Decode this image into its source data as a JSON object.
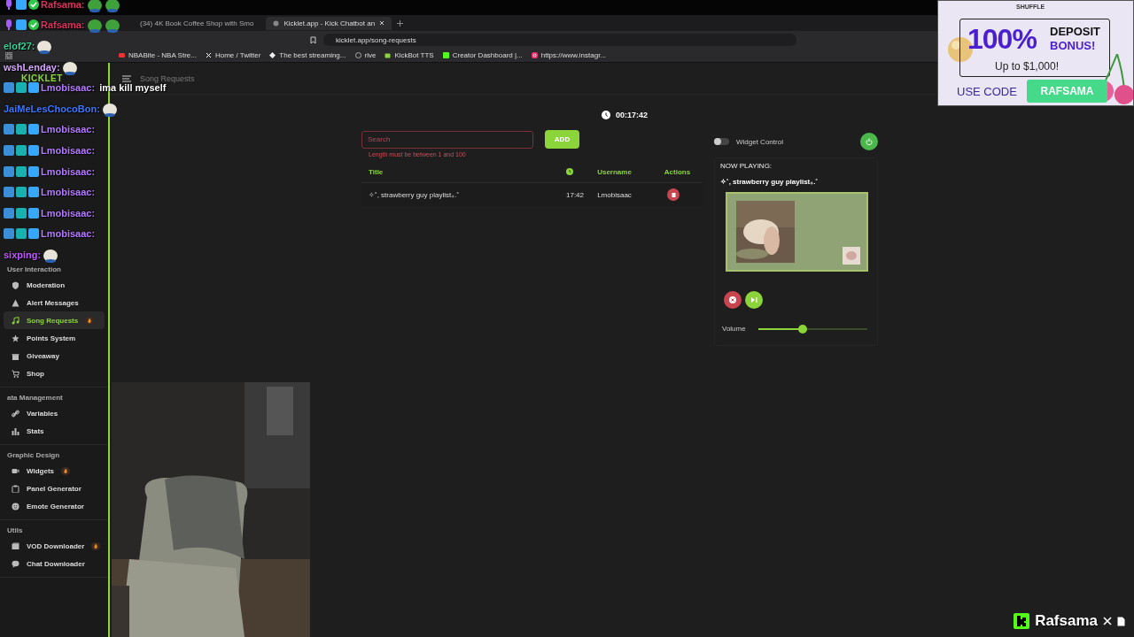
{
  "browser": {
    "tabs": [
      {
        "title": "(34) 4K Book Coffee Shop with Smo",
        "selected": false
      },
      {
        "title": "Kicklet.app - Kick Chatbot an",
        "selected": true
      }
    ],
    "url": "kicklet.app/song-requests",
    "bookmarks": [
      {
        "label": "NBABite - NBA Stre...",
        "kind": "video"
      },
      {
        "label": "Home / Twitter",
        "kind": "x"
      },
      {
        "label": "The best streaming...",
        "kind": "diamond"
      },
      {
        "label": "rive",
        "kind": "globe"
      },
      {
        "label": "KickBot TTS",
        "kind": "bot"
      },
      {
        "label": "Creator Dashboard |...",
        "kind": "kick"
      },
      {
        "label": "https://www.instagr...",
        "kind": "insta"
      }
    ]
  },
  "app": {
    "logo": "KICKLET",
    "page_title": "Song Requests",
    "sidebar": [
      {
        "title": "User Interaction",
        "items": [
          {
            "label": "Moderation",
            "kind": "shield",
            "selected": false,
            "hot": false
          },
          {
            "label": "Alert Messages",
            "kind": "alert",
            "selected": false,
            "hot": false
          },
          {
            "label": "Song Requests",
            "kind": "music",
            "selected": true,
            "hot": true
          },
          {
            "label": "Points System",
            "kind": "star",
            "selected": false,
            "hot": false
          },
          {
            "label": "Giveaway",
            "kind": "gift",
            "selected": false,
            "hot": false
          },
          {
            "label": "Shop",
            "kind": "cart",
            "selected": false,
            "hot": false
          }
        ]
      },
      {
        "title": "ata Management",
        "items": [
          {
            "label": "Variables",
            "kind": "link",
            "selected": false,
            "hot": false
          },
          {
            "label": "Stats",
            "kind": "chart",
            "selected": false,
            "hot": false
          }
        ]
      },
      {
        "title": "Graphic Design",
        "items": [
          {
            "label": "Widgets",
            "kind": "video",
            "selected": false,
            "hot": true
          },
          {
            "label": "Panel Generator",
            "kind": "panel",
            "selected": false,
            "hot": false
          },
          {
            "label": "Emote Generator",
            "kind": "smile",
            "selected": false,
            "hot": false
          }
        ]
      },
      {
        "title": "Utils",
        "items": [
          {
            "label": "VOD Downloader",
            "kind": "film",
            "selected": false,
            "hot": true
          },
          {
            "label": "Chat Downloader",
            "kind": "chat",
            "selected": false,
            "hot": false
          }
        ]
      }
    ],
    "timer": "00:17:42",
    "search": {
      "placeholder": "Search",
      "error": "Length must be between 1 and 100"
    },
    "add_button": "ADD",
    "table": {
      "columns": [
        "Title",
        "Username",
        "Actions"
      ],
      "rows": [
        {
          "title": "✧˚, strawberry guy playlist₊.˚",
          "duration": "17:42",
          "username": "Lmobisaac"
        }
      ]
    },
    "widget_control": {
      "label": "Widget Control",
      "on": false
    },
    "now_playing": {
      "heading": "NOW PLAYING:",
      "title": "✧˚, strawberry guy playlist₊.˚",
      "volume_label": "Volume",
      "level": 0.41
    }
  },
  "stream_overlay": {
    "chat": [
      {
        "user": "Rafsama:",
        "color": "#e0305f",
        "kind": "broadcaster",
        "emote": true
      },
      {
        "user": "Rafsama:",
        "color": "#e0305f",
        "kind": "broadcaster",
        "emote": true
      },
      {
        "user": "elof27:",
        "color": "#36d39a",
        "kind": "viewer",
        "emote": true
      },
      {
        "user": "wshLenday:",
        "color": "#d7a6ff",
        "kind": "viewer",
        "emote": true
      },
      {
        "user": "Lmobisaac:",
        "color": "#b57cff",
        "kind": "subscriber",
        "message": "ima kill myself",
        "emote": false
      },
      {
        "user": "JaiMeLesChocoBon:",
        "color": "#3b78ff",
        "kind": "viewer",
        "emote": true
      },
      {
        "user": "Lmobisaac:",
        "color": "#b57cff",
        "kind": "subscriber",
        "emote": false
      },
      {
        "user": "Lmobisaac:",
        "color": "#b57cff",
        "kind": "subscriber",
        "emote": false
      },
      {
        "user": "Lmobisaac:",
        "color": "#b57cff",
        "kind": "subscriber",
        "emote": false
      },
      {
        "user": "Lmobisaac:",
        "color": "#b57cff",
        "kind": "subscriber",
        "emote": false
      },
      {
        "user": "Lmobisaac:",
        "color": "#b57cff",
        "kind": "subscriber",
        "emote": false
      },
      {
        "user": "Lmobisaac:",
        "color": "#b57cff",
        "kind": "subscriber",
        "emote": false
      },
      {
        "user": "sixping:",
        "color": "#c05cff",
        "kind": "viewer",
        "emote": true
      }
    ],
    "sponsor_ad": {
      "brand": "SHUFFLE",
      "headline": "100%",
      "headline_side": [
        "DEPOSIT",
        "BONUS!"
      ],
      "subline": "Up to $1,000!",
      "code_label": "USE CODE",
      "code": "RAFSAMA"
    },
    "channel_tag": {
      "name": "Rafsama"
    }
  }
}
